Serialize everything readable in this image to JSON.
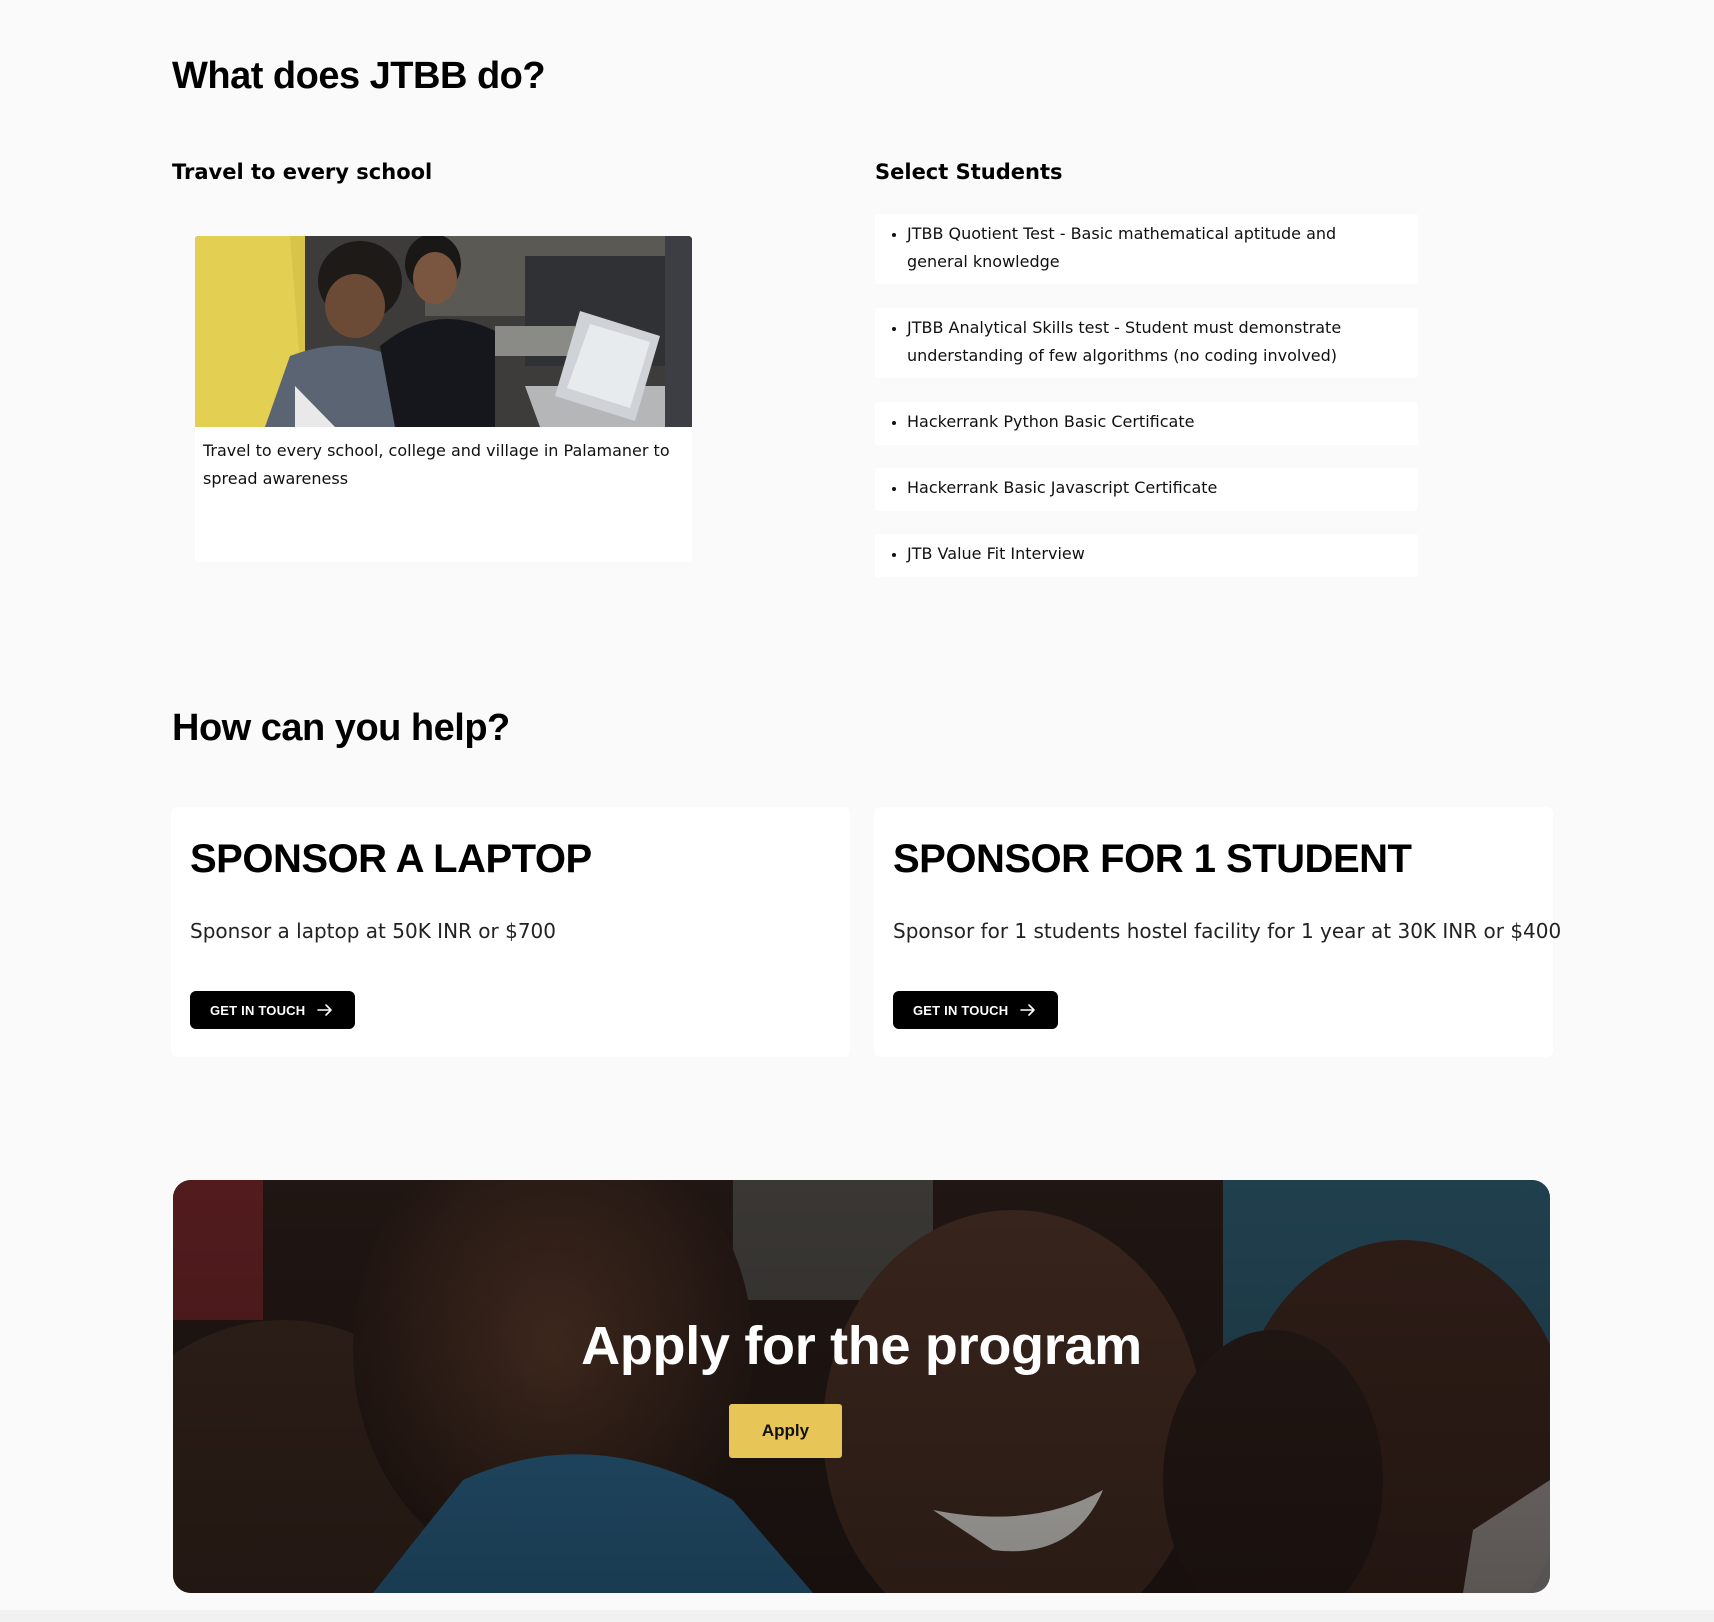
{
  "what_section": {
    "heading": "What does JTBB do?",
    "travel": {
      "subheading": "Travel to every school",
      "caption": "Travel to every school, college and village in Palamaner to spread awareness"
    },
    "select": {
      "subheading": "Select Students",
      "items": [
        "JTBB Quotient Test - Basic mathematical aptitude and general knowledge",
        "JTBB Analytical Skills test - Student must demonstrate understanding of few algorithms (no coding involved)",
        "Hackerrank Python Basic Certificate",
        "Hackerrank Basic Javascript Certificate",
        "JTB Value Fit Interview"
      ]
    }
  },
  "help_section": {
    "heading": "How can you help?",
    "cards": [
      {
        "title": "SPONSOR A LAPTOP",
        "description": "Sponsor a laptop at 50K INR or $700",
        "button": "GET IN TOUCH"
      },
      {
        "title": "SPONSOR FOR 1 STUDENT",
        "description": "Sponsor for 1 students hostel facility for 1 year at 30K INR or $400",
        "button": "GET IN TOUCH"
      }
    ]
  },
  "apply_section": {
    "title": "Apply for the program",
    "button": "Apply"
  },
  "icons": {
    "button_icon": "arrow-right-icon"
  },
  "colors": {
    "page_background": "#fafafa",
    "card_background": "#ffffff",
    "button_dark": "#000000",
    "apply_button": "#e8c557"
  }
}
